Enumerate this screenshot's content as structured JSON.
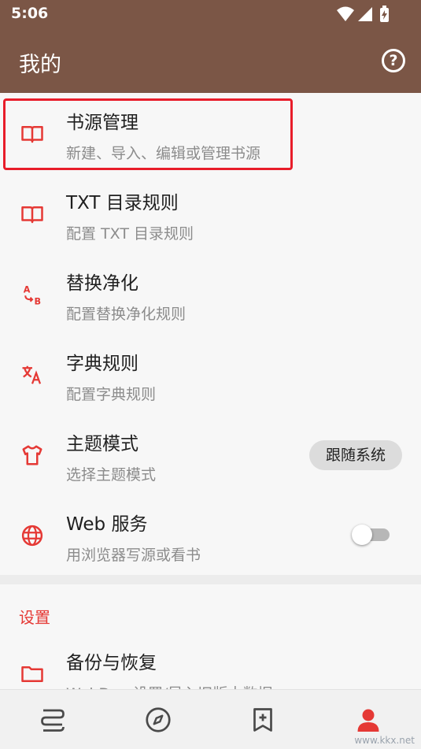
{
  "status": {
    "time": "5:06",
    "icons": [
      "wifi-icon",
      "signal-icon",
      "battery-icon"
    ]
  },
  "appbar": {
    "title": "我的",
    "help_icon": "help-circle-icon"
  },
  "items": [
    {
      "title": "书源管理",
      "subtitle": "新建、导入、编辑或管理书源",
      "icon": "book-open-icon"
    },
    {
      "title": "TXT 目录规则",
      "subtitle": "配置 TXT 目录规则",
      "icon": "book-open-icon"
    },
    {
      "title": "替换净化",
      "subtitle": "配置替换净化规则",
      "icon": "replace-ab-icon"
    },
    {
      "title": "字典规则",
      "subtitle": "配置字典规则",
      "icon": "translate-icon"
    },
    {
      "title": "主题模式",
      "subtitle": "选择主题模式",
      "icon": "tshirt-icon",
      "chip": "跟随系统"
    },
    {
      "title": "Web 服务",
      "subtitle": "用浏览器写源或看书",
      "icon": "globe-icon",
      "toggle_on": false
    }
  ],
  "settings": {
    "section_title": "设置",
    "items": [
      {
        "title": "备份与恢复",
        "subtitle": "WebDav 设置/导入旧版本数据",
        "icon": "folder-icon"
      }
    ]
  },
  "bottom_nav": [
    "bookshelf-icon",
    "explore-icon",
    "bookmark-add-icon",
    "my-profile-icon"
  ],
  "watermark": "www.kkx.net",
  "colors": {
    "primary": "#7b5646",
    "accent": "#e53935",
    "highlight": "#e81d2a"
  }
}
